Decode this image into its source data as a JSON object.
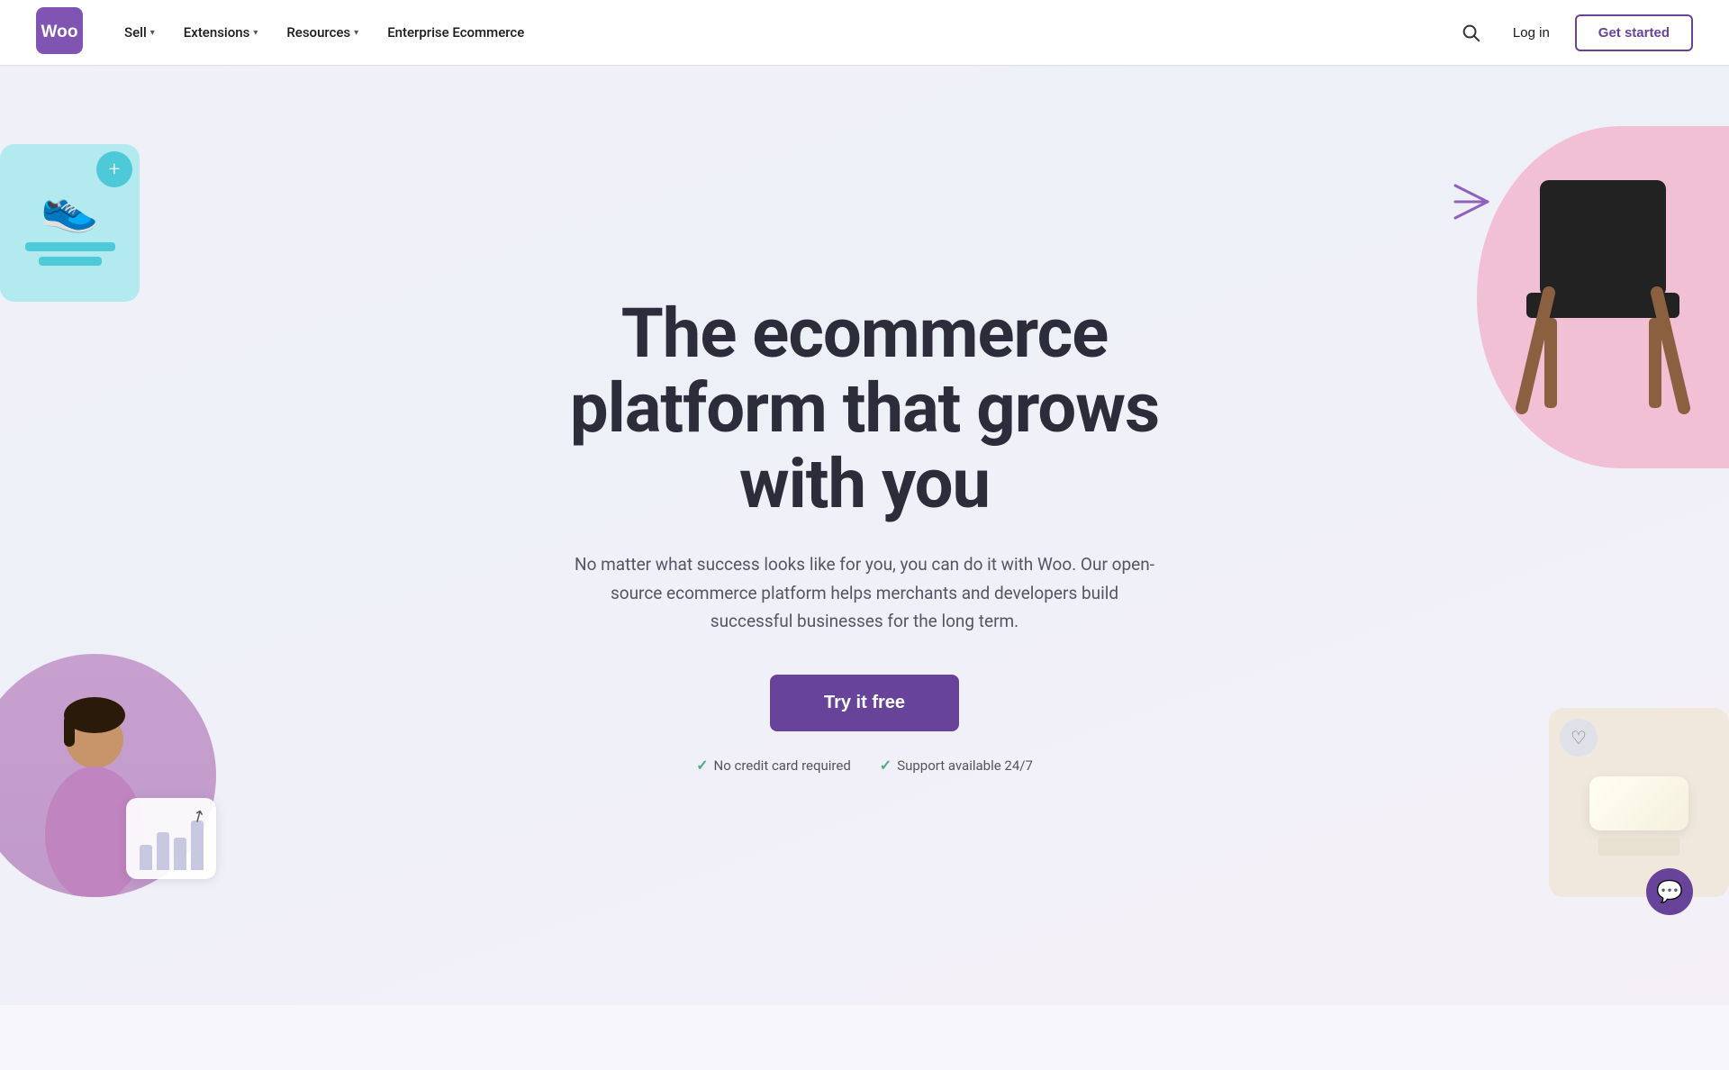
{
  "nav": {
    "logo_alt": "WooCommerce",
    "links": [
      {
        "label": "Sell",
        "has_dropdown": true
      },
      {
        "label": "Extensions",
        "has_dropdown": true
      },
      {
        "label": "Resources",
        "has_dropdown": true
      },
      {
        "label": "Enterprise Ecommerce",
        "has_dropdown": false
      }
    ],
    "search_label": "Search",
    "login_label": "Log in",
    "get_started_label": "Get started"
  },
  "hero": {
    "title_line1": "The ecommerce",
    "title_line2": "platform that grows",
    "title_line3": "with you",
    "subtitle": "No matter what success looks like for you, you can do it with Woo. Our open-source ecommerce platform helps merchants and developers build successful businesses for the long term.",
    "cta_label": "Try it free",
    "check1": "No credit card required",
    "check2": "Support available 24/7"
  },
  "colors": {
    "brand_purple": "#674399",
    "brand_teal": "#4ec9d8",
    "brand_pink": "#f2c0d5",
    "check_green": "#4caf7d"
  },
  "chat": {
    "icon": "💬"
  }
}
